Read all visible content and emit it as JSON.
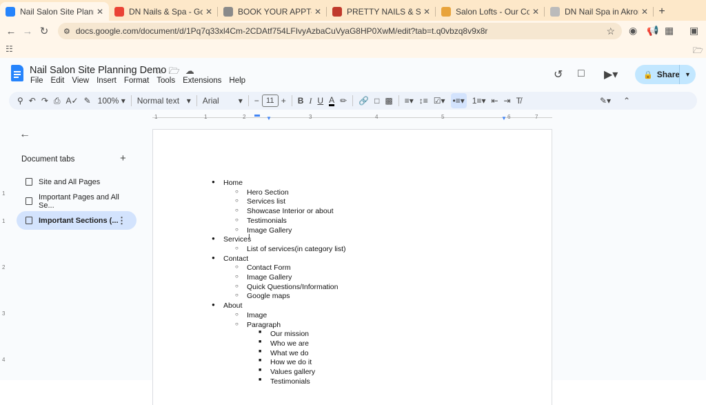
{
  "browser": {
    "tabs": [
      {
        "title": "Nail Salon Site Planning Demo",
        "favicon": "docs-icon",
        "color": "#2684fc",
        "active": true
      },
      {
        "title": "DN Nails & Spa - Google Maps",
        "favicon": "maps-pin-icon",
        "color": "#ea4335",
        "active": false
      },
      {
        "title": "BOOK YOUR APPT-Wichita",
        "favicon": "m-logo-icon",
        "color": "#8a8a8a",
        "active": false
      },
      {
        "title": "PRETTY NAILS & SPA - About",
        "favicon": "hand-icon",
        "color": "#c0392b",
        "active": false
      },
      {
        "title": "Salon Lofts - Our Company",
        "favicon": "sl-logo-icon",
        "color": "#e8a33b",
        "active": false
      },
      {
        "title": "DN Nail Spa in Akron, OH",
        "favicon": "dash-icon",
        "color": "#bbbbbb",
        "active": false
      }
    ],
    "url": "docs.google.com/document/d/1Pq7q33xl4Cm-2CDAtf754LFIvyAzbaCuVyaG8HP0XwM/edit?tab=t.q0vbzq8v9x8r"
  },
  "doc": {
    "title": "Nail Salon Site Planning Demo",
    "menus": [
      "File",
      "Edit",
      "View",
      "Insert",
      "Format",
      "Tools",
      "Extensions",
      "Help"
    ],
    "share_label": "Share"
  },
  "toolbar": {
    "zoom": "100%",
    "style": "Normal text",
    "font": "Arial",
    "font_size": "11"
  },
  "ruler": {
    "ticks": [
      "1",
      "1",
      "2",
      "3",
      "4",
      "5",
      "6",
      "7"
    ],
    "vticks": [
      "1",
      "1",
      "2",
      "3",
      "4"
    ]
  },
  "sidebar": {
    "heading": "Document tabs",
    "items": [
      {
        "label": "Site and All Pages",
        "selected": false
      },
      {
        "label": "Important Pages and All Se...",
        "selected": false
      },
      {
        "label": "Important Sections (...",
        "selected": true
      }
    ]
  },
  "content": [
    {
      "level": 1,
      "text": "Home"
    },
    {
      "level": 2,
      "text": "Hero Section"
    },
    {
      "level": 2,
      "text": "Services list"
    },
    {
      "level": 2,
      "text": "Showcase Interior or about"
    },
    {
      "level": 2,
      "text": "Testimonials"
    },
    {
      "level": 2,
      "text": "Image Gallery"
    },
    {
      "level": 1,
      "text": "Services"
    },
    {
      "level": 2,
      "text": "List of services(in category list)"
    },
    {
      "level": 1,
      "text": "Contact"
    },
    {
      "level": 2,
      "text": "Contact Form"
    },
    {
      "level": 2,
      "text": "Image Gallery"
    },
    {
      "level": 2,
      "text": "Quick Questions/Information"
    },
    {
      "level": 2,
      "text": "Google maps"
    },
    {
      "level": 1,
      "text": "About"
    },
    {
      "level": 2,
      "text": "Image"
    },
    {
      "level": 2,
      "text": "Paragraph"
    },
    {
      "level": 3,
      "text": "Our mission"
    },
    {
      "level": 3,
      "text": "Who we are"
    },
    {
      "level": 3,
      "text": "What we do"
    },
    {
      "level": 3,
      "text": "How we do it"
    },
    {
      "level": 3,
      "text": "Values gallery"
    },
    {
      "level": 3,
      "text": "Testimonials"
    }
  ]
}
